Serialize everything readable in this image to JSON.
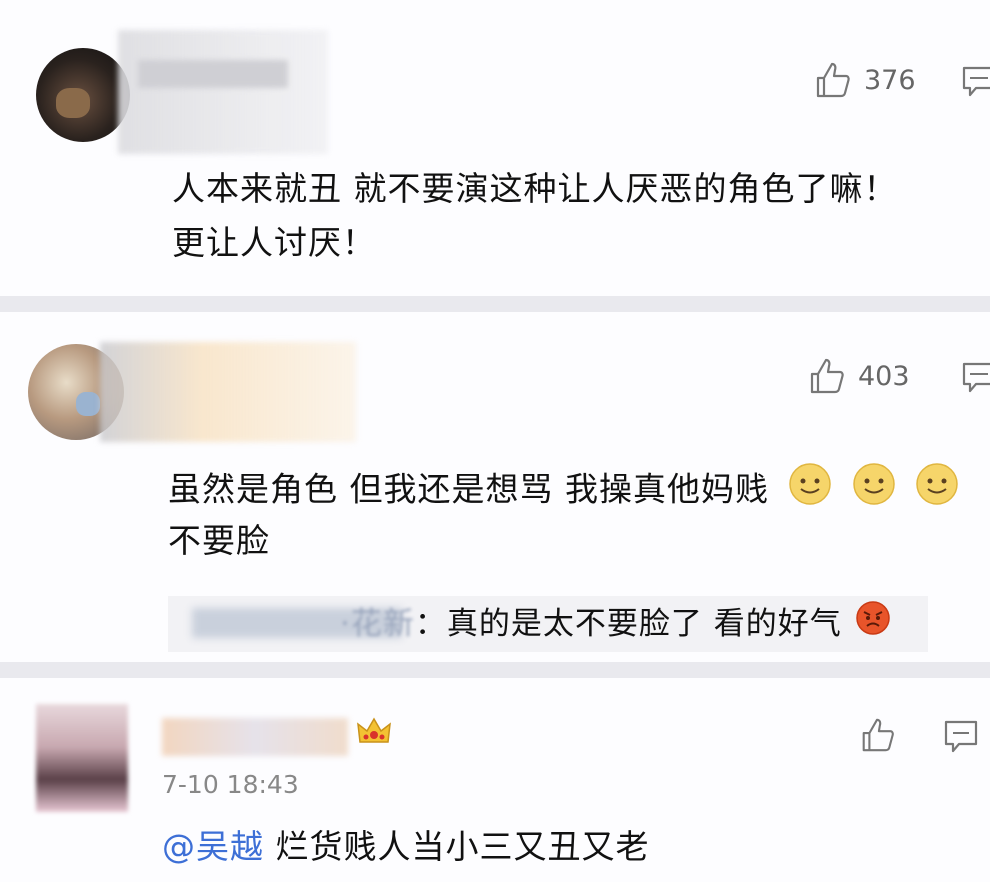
{
  "comments": [
    {
      "likes": "376",
      "text_lines": [
        "人本来就丑 就不要演这种让人厌恶的角色了嘛！",
        "更让人讨厌！"
      ]
    },
    {
      "likes": "403",
      "text_line1": "虽然是角色 但我还是想骂 我操真他妈贱",
      "text_line2": "不要脸",
      "emojis": [
        "smile-emoji",
        "smile-emoji",
        "smile-emoji"
      ],
      "reply": {
        "name_fragment": "·花新",
        "text": "：真的是太不要脸了 看的好气",
        "emoji": "angry-emoji"
      }
    },
    {
      "time": "7-10 18:43",
      "mention": "@吴越",
      "text": " 烂货贱人当小三又丑又老",
      "badge": "crown-badge"
    }
  ],
  "icons": {
    "like": "thumbs-up-icon",
    "reply": "comment-icon"
  }
}
